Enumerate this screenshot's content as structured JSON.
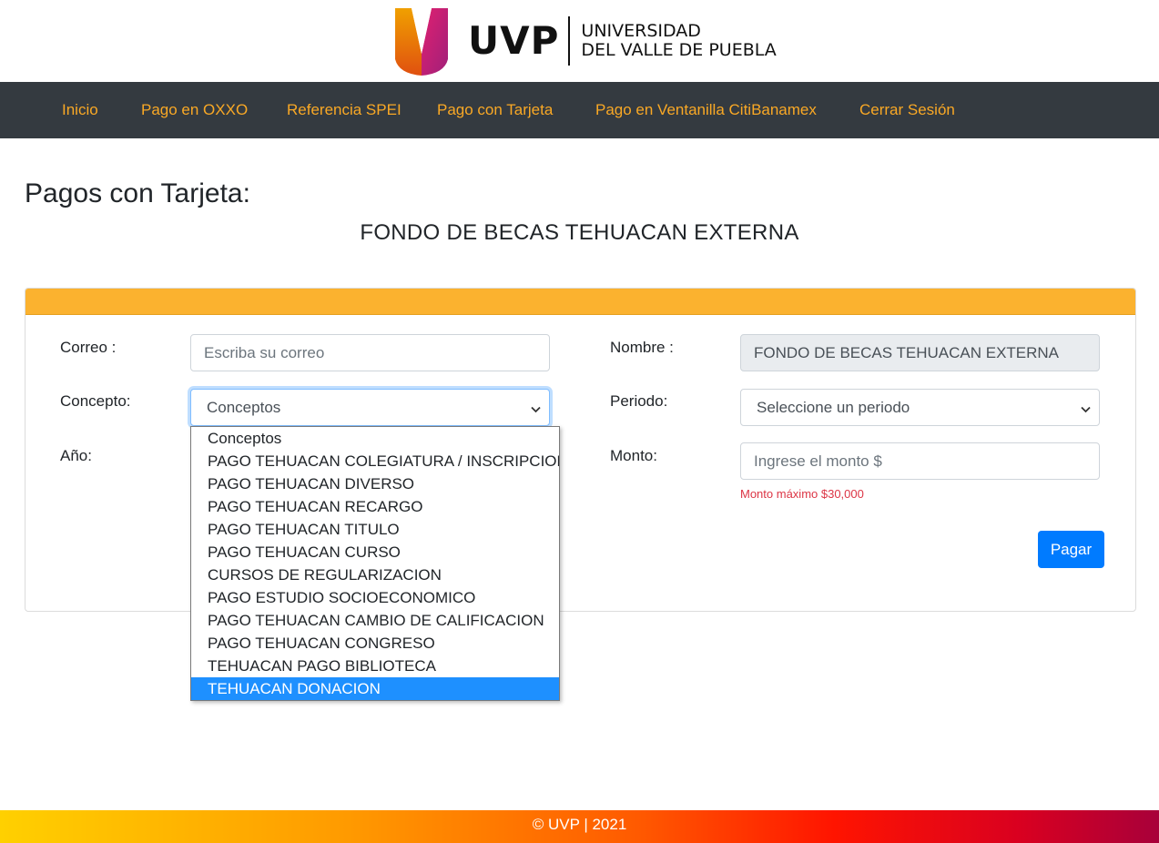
{
  "brand": {
    "uvp": "UVP",
    "name_line1": "UNIVERSIDAD",
    "name_line2": "DEL VALLE DE PUEBLA"
  },
  "nav": {
    "items": [
      {
        "label": "Inicio"
      },
      {
        "label": "Pago en OXXO"
      },
      {
        "label": "Referencia SPEI"
      },
      {
        "label": "Pago con Tarjeta"
      },
      {
        "label": "Pago en Ventanilla CitiBanamex"
      },
      {
        "label": "Cerrar Sesión"
      }
    ],
    "color": "#f9a825"
  },
  "page": {
    "title": "Pagos con Tarjeta:",
    "subtitle": "FONDO DE BECAS TEHUACAN EXTERNA"
  },
  "form": {
    "correo_label": "Correo :",
    "correo_placeholder": "Escriba su correo",
    "concepto_label": "Concepto:",
    "concepto_value": "Conceptos",
    "anio_label": "Año:",
    "nombre_label": "Nombre :",
    "nombre_value": "FONDO DE BECAS  TEHUACAN EXTERNA",
    "periodo_label": "Periodo:",
    "periodo_value": "Seleccione un periodo",
    "monto_label": "Monto:",
    "monto_placeholder": "Ingrese el monto $",
    "monto_hint": "Monto máximo $30,000",
    "submit_label": "Pagar"
  },
  "concepto_options": [
    {
      "label": "Conceptos"
    },
    {
      "label": "PAGO TEHUACAN COLEGIATURA / INSCRIPCION"
    },
    {
      "label": "PAGO TEHUACAN DIVERSO"
    },
    {
      "label": "PAGO TEHUACAN RECARGO"
    },
    {
      "label": "PAGO TEHUACAN TITULO"
    },
    {
      "label": "PAGO TEHUACAN CURSO"
    },
    {
      "label": "CURSOS DE REGULARIZACION"
    },
    {
      "label": "PAGO ESTUDIO SOCIOECONOMICO"
    },
    {
      "label": "PAGO TEHUACAN CAMBIO DE CALIFICACION"
    },
    {
      "label": "PAGO TEHUACAN CONGRESO"
    },
    {
      "label": "TEHUACAN PAGO BIBLIOTECA"
    },
    {
      "label": "TEHUACAN DONACION"
    }
  ],
  "concepto_highlighted": "TEHUACAN DONACION",
  "footer": {
    "text": "© UVP | 2021"
  },
  "colors": {
    "accent": "#fbb22f",
    "nav_bg": "#343a40",
    "primary": "#007bff",
    "danger": "#dc3545",
    "highlight": "#1e90ff"
  },
  "icons": {
    "logo": "uvp-logo-mark",
    "select_arrow": "chevron-down-icon"
  }
}
